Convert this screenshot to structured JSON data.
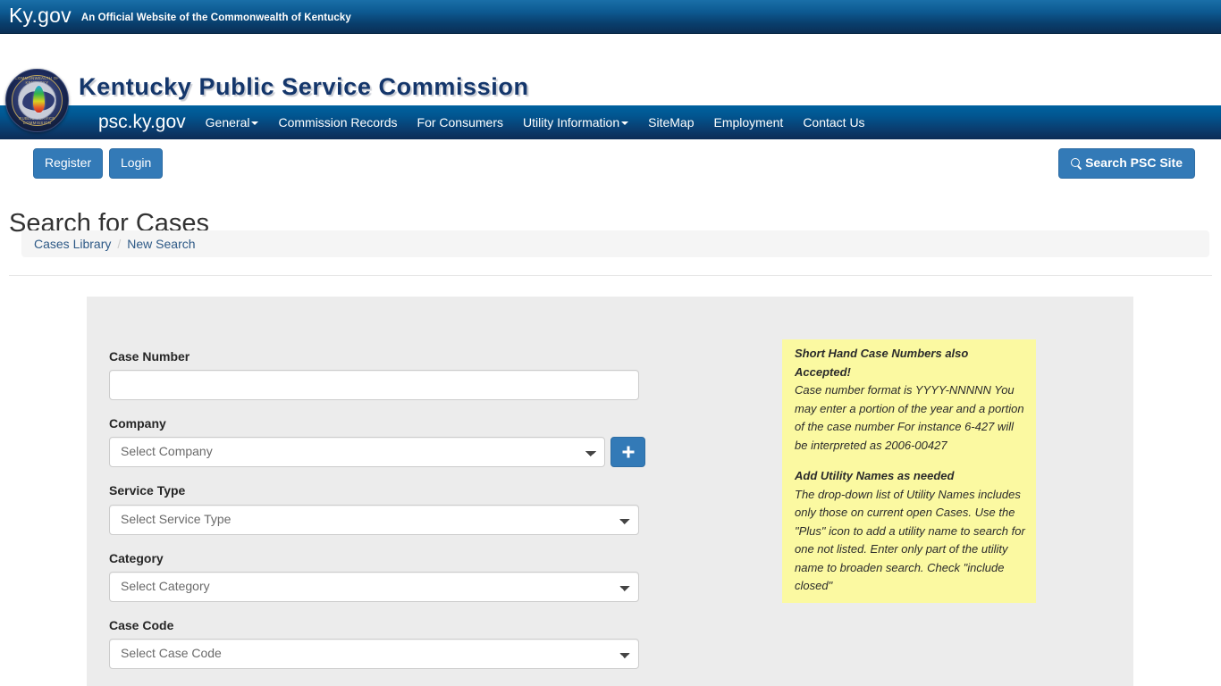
{
  "topbar": {
    "logo": "Ky.gov",
    "tagline": "An Official Website of the Commonwealth of Kentucky"
  },
  "header": {
    "site_title": "Kentucky Public Service Commission",
    "seal_top_text": "COMMONWEALTH OF KENTUCKY",
    "seal_bottom_text": "PUBLIC SERVICE COMMISSION"
  },
  "nav": {
    "brand": "psc.ky.gov",
    "items": [
      {
        "label": "General",
        "caret": true
      },
      {
        "label": "Commission Records",
        "caret": false
      },
      {
        "label": "For Consumers",
        "caret": false
      },
      {
        "label": "Utility Information",
        "caret": true
      },
      {
        "label": "SiteMap",
        "caret": false
      },
      {
        "label": "Employment",
        "caret": false
      },
      {
        "label": "Contact Us",
        "caret": false
      }
    ]
  },
  "actions": {
    "register": "Register",
    "login": "Login",
    "search_site": "Search PSC Site"
  },
  "page": {
    "title": "Search for Cases"
  },
  "breadcrumb": {
    "items": [
      "Cases Library",
      "New Search"
    ],
    "separator": "/"
  },
  "form": {
    "case_number": {
      "label": "Case Number",
      "value": "",
      "placeholder": ""
    },
    "company": {
      "label": "Company",
      "selected": "Select Company",
      "add_button_title": "Add utility name"
    },
    "service_type": {
      "label": "Service Type",
      "selected": "Select Service Type"
    },
    "category": {
      "label": "Category",
      "selected": "Select Category"
    },
    "case_code": {
      "label": "Case Code",
      "selected": "Select Case Code"
    }
  },
  "notes": {
    "case_number": {
      "title": "Short Hand Case Numbers also Accepted!",
      "lines": "Case number format is YYYY-NNNNN You may enter a portion of the year and a portion of the case number For instance 6-427 will be interpreted as 2006-00427",
      "line1": "Case number format is YYYY-NNNNN",
      "line2": "You may enter a portion of the year and a portion of the case number",
      "line3": "For instance 6-427 will be interpreted as 2006-00427"
    },
    "utility": {
      "title": "Add Utility Names as needed",
      "line1": "The drop-down list of Utility Names includes only those on current open Cases.",
      "line2": "Use the \"Plus\" icon to add a utility name to search for one not listed. Enter only part of the utility name to broaden search.",
      "line3": "Check \"include closed\""
    }
  },
  "colors": {
    "brand_blue": "#337ab7",
    "nav_blue_top": "#00629f",
    "nav_blue_bottom": "#0c2c56",
    "title_navy": "#14366b",
    "note_yellow": "#fbf9a1",
    "panel_gray": "#ececec"
  }
}
